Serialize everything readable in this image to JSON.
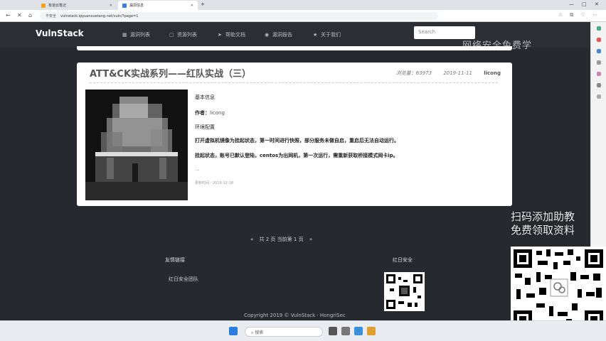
{
  "browser": {
    "tabs": [
      {
        "label": "有道云笔记"
      },
      {
        "label": "漏洞信息"
      }
    ],
    "insecure_label": "不安全",
    "url": "vulnstack.qiyuanxuetang.net/vuln/?page=1"
  },
  "site": {
    "logo": "VulnStack",
    "nav": [
      {
        "label": "漏洞列表"
      },
      {
        "label": "资源列表"
      },
      {
        "label": "帮助文档"
      },
      {
        "label": "漏洞报告"
      },
      {
        "label": "关于我们"
      }
    ],
    "search_placeholder": "Search"
  },
  "overlay": {
    "watermark_top": "网络安全免费学",
    "promo_line1": "扫码添加助教",
    "promo_line2": "免费领取资料"
  },
  "card": {
    "title": "ATT&CK实战系列——红队实战（三）",
    "views_label": "浏览量：",
    "views": "63973",
    "date": "2019-11-11",
    "author": "licong",
    "section_basic": "基本信息",
    "author_label": "作者：",
    "author_value": "licong",
    "section_env": "环境配置",
    "env_line1": "打开虚拟机镜像为挂起状态，第一时间进行快照，部分服务未做自启，重启后无法自动运行。",
    "env_line2": "挂起状态，账号已默认登陆，centos为出网机，第一次运行，需重新获取桥接模式网卡ip。",
    "ellipsis": "...",
    "updated": "更新时间：2019-12-18"
  },
  "pagination": {
    "prev": "«",
    "text": "共 2 页   当前第  1  页",
    "next": "»"
  },
  "footer": {
    "links_title": "友情链接",
    "link1": "红日安全团队",
    "org_title": "红日安全",
    "copyright": "Copyright 2019 © VulnStack · HongriSec"
  },
  "taskbar": {
    "search": "搜索"
  }
}
